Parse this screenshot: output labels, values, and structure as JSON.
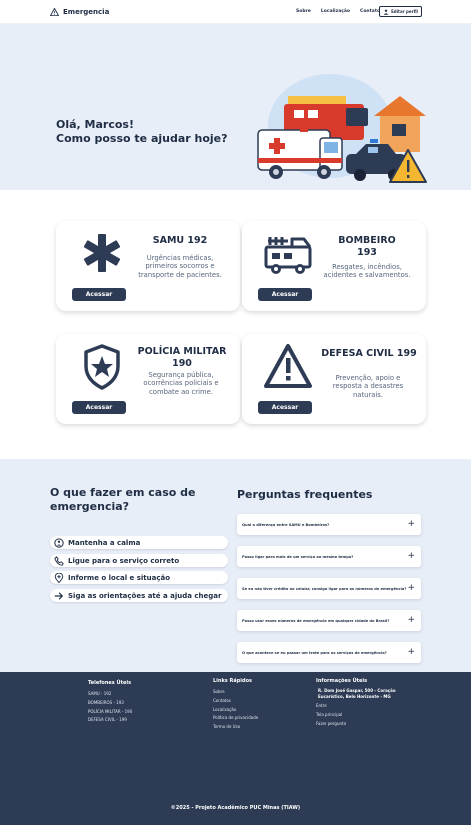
{
  "header": {
    "brand": "Emergencia",
    "nav": [
      "Sobre",
      "Localização",
      "Contatos"
    ],
    "edit_profile": "Editar perfil"
  },
  "hero": {
    "greeting_line1": "Olá, Marcos!",
    "greeting_line2": "Como posso te ajudar hoje?"
  },
  "services": [
    {
      "title": "SAMU 192",
      "desc": "Urgências médicas, primeiros socorros e transporte de pacientes.",
      "button": "Acessar",
      "icon": "medical-star-icon"
    },
    {
      "title": "BOMBEIRO 193",
      "desc": "Resgates, incêndios, acidentes e salvamentos.",
      "button": "Acessar",
      "icon": "fire-truck-icon"
    },
    {
      "title": "POLÍCIA MILITAR 190",
      "desc": "Segurança pública, ocorrências policiais e combate ao crime.",
      "button": "Acessar",
      "icon": "police-badge-icon"
    },
    {
      "title": "DEFESA CIVIL 199",
      "desc": "Prevenção, apoio e resposta a desastres naturais.",
      "button": "Acessar",
      "icon": "warning-triangle-icon"
    }
  ],
  "what_to_do": {
    "title": "O que fazer em caso de emergencia?",
    "steps": [
      "Mantenha a calma",
      "Ligue para o serviço correto",
      "Informe o local e situação",
      "Siga as orientações até a ajuda chegar"
    ]
  },
  "faq": {
    "title": "Perguntas frequentes",
    "items": [
      "Qual a diferença entre SAMU e Bombeiros?",
      "Posso ligar para mais de um serviço ao mesmo tempo?",
      "Se eu não tiver crédito no celular, consigo ligar para os números de emergência?",
      "Posso usar esses números de emergência em qualquer cidade do Brasil?",
      "O que acontece se eu passar um trote para os serviços de emergência?"
    ]
  },
  "footer": {
    "phones_title": "Telefones Úteis",
    "phones": [
      "SAMU - 192",
      "BOMBEIROS - 193",
      "POLÍCIA MILITAR - 190",
      "DEFESA CIVIL - 199"
    ],
    "links_title": "Links Rápidos",
    "links": [
      "Sobre",
      "Contatos",
      "Localização",
      "Política de privacidade",
      "Termo de Uso"
    ],
    "info_title": "Informações Úteis",
    "address": "R. Dom José Gaspar, 500 - Coração Eucarístico, Belo Horizonte - MG",
    "info_links": [
      "Entre",
      "Tela principal",
      "Fazer pergunta"
    ],
    "copyright": "©2025 - Projeto Acadêmico PUC Minas (TIAW)"
  },
  "colors": {
    "navy": "#2d3b55",
    "hero_bg": "#e8eef8",
    "text": "#1f2d44",
    "red": "#e53935",
    "yellow": "#f5b731"
  }
}
